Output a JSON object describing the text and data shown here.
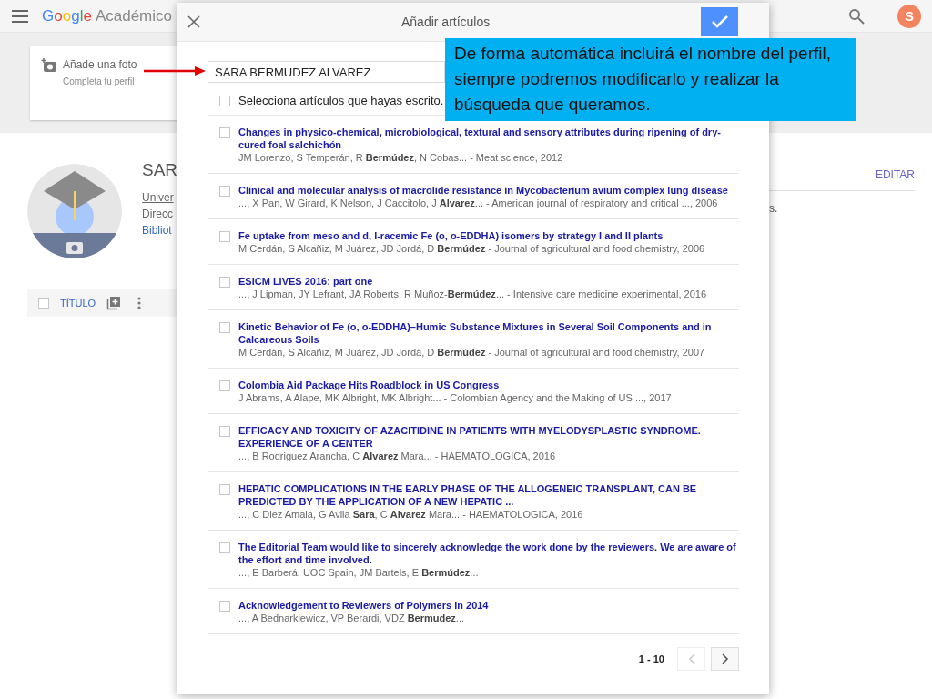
{
  "top_bar": {
    "logo": "Google",
    "product": "Académico",
    "avatar": "S"
  },
  "background": {
    "photo_card": {
      "title": "Añade una foto",
      "subtitle": "Completa tu perfil"
    },
    "profile": {
      "name": "SAR",
      "lines": [
        "Univer",
        "Direcc",
        "Bibliot"
      ],
      "edit": "EDITAR",
      "fragment": "s."
    },
    "table_header": {
      "column": "TÍTULO",
      "checked": false
    }
  },
  "dialog": {
    "title": "Añadir artículos",
    "search": {
      "value": "SARA BERMUDEZ ALVAREZ"
    },
    "select_all": {
      "label": "Selecciona artículos que hayas escrito.",
      "checked": false
    },
    "articles": [
      {
        "title": "Changes in physico-chemical, microbiological, textural and sensory attributes during ripening of dry-cured foal salchichón",
        "authors": "JM Lorenzo, S Temperán, R **Bermúdez**, N Cobas... - Meat science, 2012",
        "checked": false
      },
      {
        "title": "Clinical and molecular analysis of macrolide resistance in Mycobacterium avium complex lung disease",
        "authors": "..., X Pan, W Girard, K Nelson, J Caccitolo, J **Alvarez**... - American journal of respiratory and critical ..., 2006",
        "checked": false
      },
      {
        "title": "Fe uptake from meso and d, l-racemic Fe (o, o-EDDHA) isomers by strategy I and II plants",
        "authors": "M Cerdán, S Alcañiz, M Juárez, JD Jordá, D **Bermúdez** - Journal of agricultural and food chemistry, 2006",
        "checked": false
      },
      {
        "title": "ESICM LIVES 2016: part one",
        "authors": "..., J Lipman, JY Lefrant, JA Roberts, R Muñoz-**Bermúdez**... - Intensive care medicine experimental, 2016",
        "checked": false
      },
      {
        "title": "Kinetic Behavior of Fe (o, o-EDDHA)–Humic Substance Mixtures in Several Soil Components and in Calcareous Soils",
        "authors": "M Cerdán, S Alcañiz, M Juárez, JD Jordá, D **Bermúdez** - Journal of agricultural and food chemistry, 2007",
        "checked": false
      },
      {
        "title": "Colombia Aid Package Hits Roadblock in US Congress",
        "authors": "J Abrams, A Alape, MK Albright, MK Albright... - Colombian Agency and the Making of US ..., 2017",
        "checked": false
      },
      {
        "title": "EFFICACY AND TOXICITY OF AZACITIDINE IN PATIENTS WITH MYELODYSPLASTIC SYNDROME. EXPERIENCE OF A CENTER",
        "authors": "..., B Rodriguez Arancha, C **Alvarez** Mara... - HAEMATOLOGICA, 2016",
        "checked": false
      },
      {
        "title": "HEPATIC COMPLICATIONS IN THE EARLY PHASE OF THE ALLOGENEIC TRANSPLANT, CAN BE PREDICTED BY THE APPLICATION OF A NEW HEPATIC ...",
        "authors": "..., C Diez Amaia, G Avila **Sara**, C **Alvarez** Mara... - HAEMATOLOGICA, 2016",
        "checked": false
      },
      {
        "title": "The Editorial Team would like to sincerely acknowledge the work done by the reviewers. We are aware of the effort and time involved.",
        "authors": "..., E Barberá, UOC Spain, JM Bartels, E **Bermúdez**...",
        "checked": false
      },
      {
        "title": "Acknowledgement to Reviewers of Polymers in 2014",
        "authors": "..., A Bednarkiewicz, VP Berardi, VDZ **Bermudez**...",
        "checked": false
      }
    ],
    "pagination": {
      "range": "1 - 10",
      "prev_disabled": true,
      "next_disabled": false
    }
  },
  "callout": {
    "text": "De forma automática incluirá el nombre del perfil, siempre podremos modificarlo y realizar la búsqueda que queramos."
  }
}
